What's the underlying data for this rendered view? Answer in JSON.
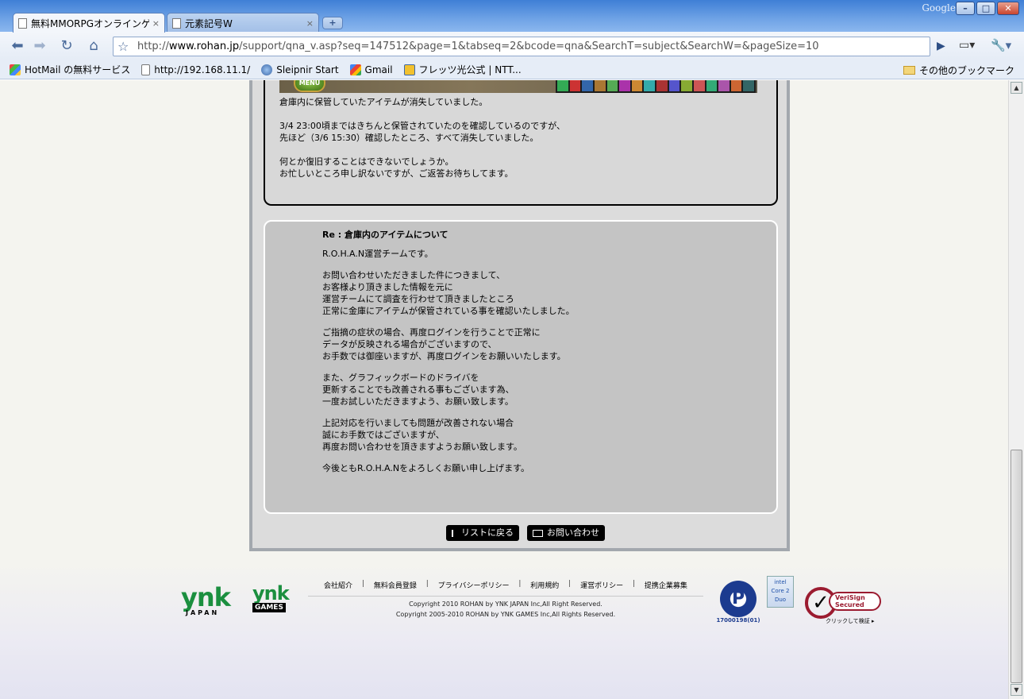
{
  "browser": {
    "google_label": "Google",
    "tabs": [
      {
        "title": "無料MMORPGオンラインゲー...",
        "close": "×"
      },
      {
        "title": "元素記号W",
        "close": "×"
      }
    ],
    "newtab_label": "+",
    "url_prefix": "http://",
    "url_host": "www.rohan.jp",
    "url_rest": "/support/qna_v.asp?seq=147512&page=1&tabseq=2&bcode=qna&SearchT=subject&SearchW=&pageSize=10",
    "bookmarks": [
      {
        "label": "HotMail の無料サービス",
        "icon": "windows-icon",
        "color": "#2b7fd4"
      },
      {
        "label": "http://192.168.11.1/",
        "icon": "page-icon",
        "color": "#ffffff"
      },
      {
        "label": "Sleipnir Start",
        "icon": "globe-icon",
        "color": "#3b67a8"
      },
      {
        "label": "Gmail",
        "icon": "google-icon",
        "color": "#4285f4"
      },
      {
        "label": "フレッツ光公式 | NTT...",
        "icon": "flets-icon",
        "color": "#f2c12e"
      }
    ],
    "other_bookmarks": "その他のブックマーク"
  },
  "question": {
    "menu_badge": "MENU",
    "paragraphs": [
      [
        "倉庫内に保管していたアイテムが消失していました。"
      ],
      [
        "3/4 23:00頃まではきちんと保管されていたのを確認しているのですが、",
        "先ほど（3/6 15:30）確認したところ、すべて消失していました。"
      ],
      [
        "何とか復旧することはできないでしょうか。",
        "お忙しいところ申し訳ないですが、ご返答お待ちしてます。"
      ]
    ]
  },
  "answer": {
    "title": "Re : 倉庫内のアイテムについて",
    "paragraphs": [
      [
        "R.O.H.A.N運営チームです。"
      ],
      [
        "お問い合わせいただきました件につきまして、",
        "お客様より頂きました情報を元に",
        "運営チームにて調査を行わせて頂きましたところ",
        "正常に金庫にアイテムが保管されている事を確認いたしました。"
      ],
      [
        "ご指摘の症状の場合、再度ログインを行うことで正常に",
        "データが反映される場合がございますので、",
        "お手数では御座いますが、再度ログインをお願いいたします。"
      ],
      [
        "また、グラフィックボードのドライバを",
        "更新することでも改善される事もございます為、",
        "一度お試しいただきますよう、お願い致します。"
      ],
      [
        "上記対応を行いましても問題が改善されない場合",
        "誠にお手数ではございますが、",
        "再度お問い合わせを頂きますようお願い致します。"
      ],
      [
        "今後ともR.O.H.A.Nをよろしくお願い申し上げます。"
      ]
    ]
  },
  "buttons": {
    "back_to_list": "リストに戻る",
    "contact": "お問い合わせ"
  },
  "footer": {
    "logo1": "ynk",
    "logo1_sub": "JAPAN",
    "logo2": "ynk",
    "logo2_sub": "GAMES",
    "links": [
      "会社紹介",
      "無料会員登録",
      "プライバシーポリシー",
      "利用規約",
      "運営ポリシー",
      "提携企業募集"
    ],
    "link_sep": "|",
    "copyright1": "Copyright 2010 ROHAN by YNK JAPAN Inc,All Right Reserved.",
    "copyright2": "Copyright 2005-2010 ROHAN by YNK GAMES Inc,All Rights Reserved.",
    "privacy_number": "17000198(01)",
    "intel_text": "intel Core 2 Duo",
    "verisign_label": "VeriSign Secured",
    "verisign_click": "クリックして検証 ▸"
  }
}
